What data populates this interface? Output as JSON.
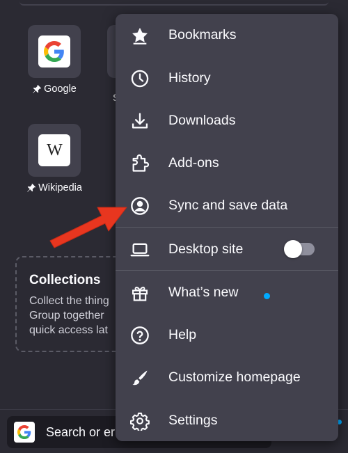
{
  "shortcuts": [
    {
      "name": "Google",
      "pinned": true,
      "icon": "google-g-icon"
    },
    {
      "name": "Wikipedia",
      "pinned": true,
      "icon": "wikipedia-w-icon",
      "glyph": "W"
    }
  ],
  "partial_shortcut_label": "S",
  "collections": {
    "title": "Collections",
    "description": "Collect the thing\nGroup together\nquick access lat"
  },
  "toolbar": {
    "search_placeholder": "Search or er"
  },
  "menu": {
    "items": [
      {
        "label": "Bookmarks",
        "icon": "star-icon"
      },
      {
        "label": "History",
        "icon": "clock-icon"
      },
      {
        "label": "Downloads",
        "icon": "download-icon"
      },
      {
        "label": "Add-ons",
        "icon": "puzzle-icon"
      },
      {
        "label": "Sync and save data",
        "icon": "account-icon"
      },
      {
        "label": "Desktop site",
        "icon": "laptop-icon",
        "toggle": false
      },
      {
        "label": "What’s new",
        "icon": "gift-icon",
        "badge": true
      },
      {
        "label": "Help",
        "icon": "help-icon"
      },
      {
        "label": "Customize homepage",
        "icon": "brush-icon"
      },
      {
        "label": "Settings",
        "icon": "gear-icon"
      }
    ]
  },
  "colors": {
    "background": "#2b2a33",
    "menu": "#42414d",
    "annotation_arrow": "#e8361f",
    "badge": "#00aaff"
  }
}
